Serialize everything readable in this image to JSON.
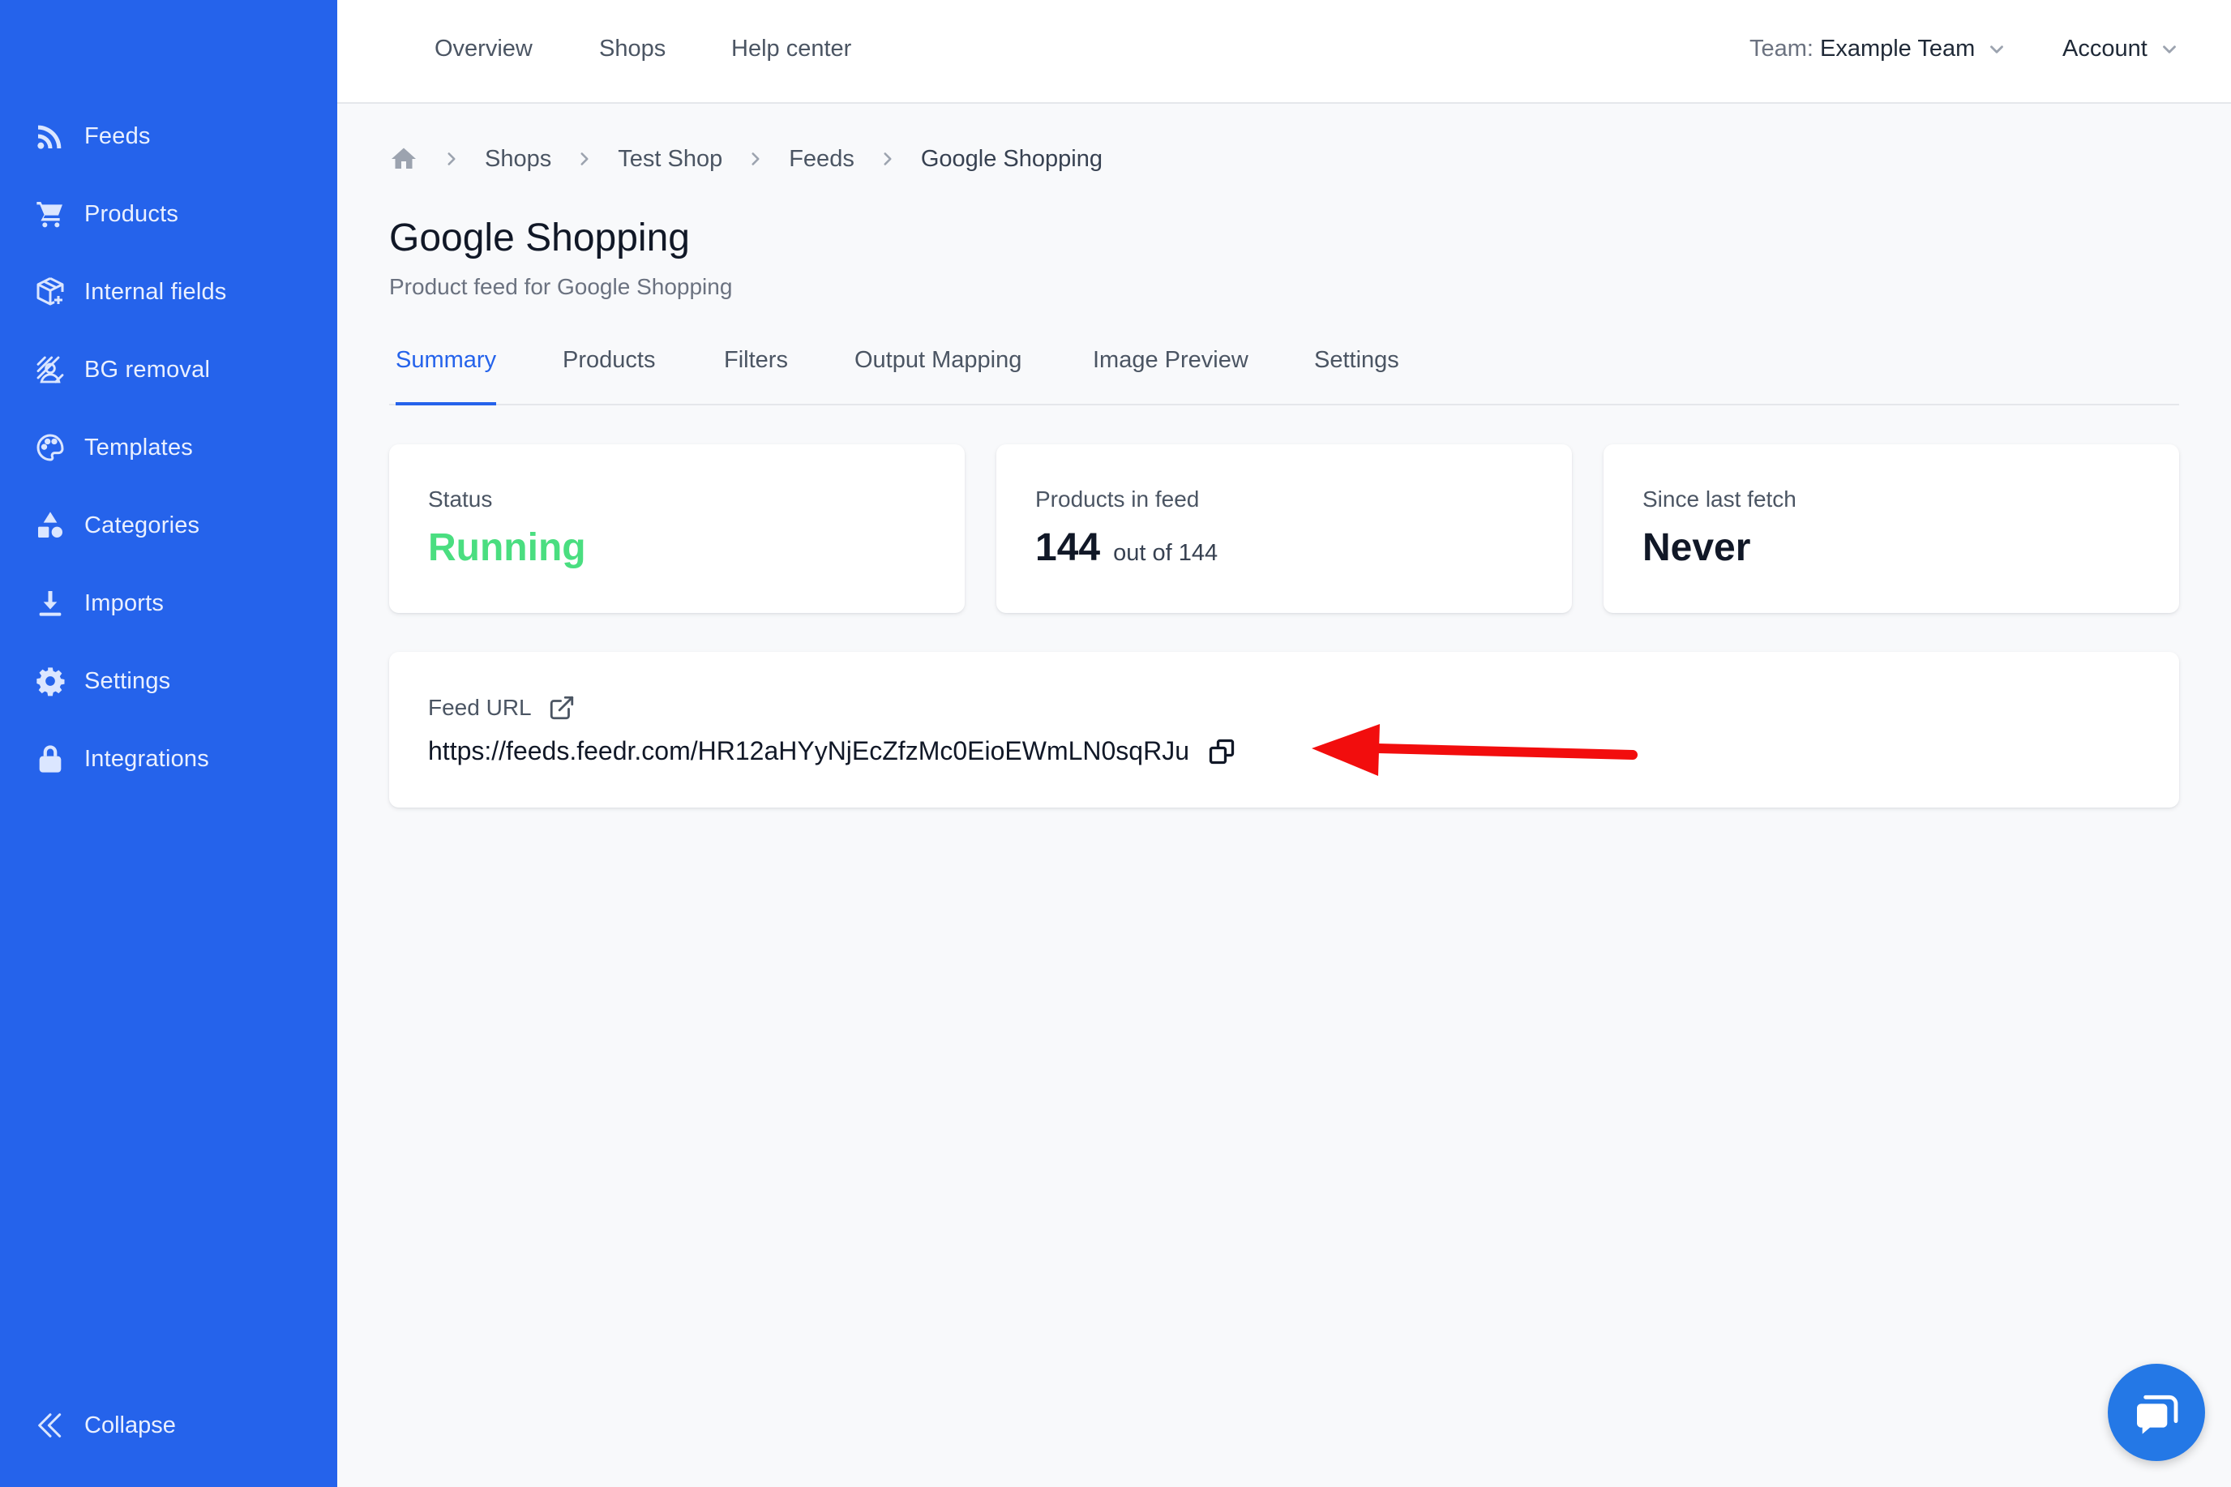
{
  "sidebar": {
    "items": [
      {
        "label": "Feeds",
        "icon": "rss-icon"
      },
      {
        "label": "Products",
        "icon": "cart-icon"
      },
      {
        "label": "Internal fields",
        "icon": "box-plus-icon"
      },
      {
        "label": "BG removal",
        "icon": "bg-removal-icon"
      },
      {
        "label": "Templates",
        "icon": "palette-icon"
      },
      {
        "label": "Categories",
        "icon": "shapes-icon"
      },
      {
        "label": "Imports",
        "icon": "download-icon"
      },
      {
        "label": "Settings",
        "icon": "gear-icon"
      },
      {
        "label": "Integrations",
        "icon": "lock-icon"
      }
    ],
    "collapse_label": "Collapse"
  },
  "topnav": {
    "links": [
      "Overview",
      "Shops",
      "Help center"
    ],
    "team_prefix": "Team:",
    "team_value": "Example Team",
    "account_label": "Account"
  },
  "breadcrumb": [
    "Shops",
    "Test Shop",
    "Feeds",
    "Google Shopping"
  ],
  "page": {
    "title": "Google Shopping",
    "subtitle": "Product feed for Google Shopping"
  },
  "tabs": [
    "Summary",
    "Products",
    "Filters",
    "Output Mapping",
    "Image Preview",
    "Settings"
  ],
  "active_tab": "Summary",
  "stats": {
    "status_label": "Status",
    "status_value": "Running",
    "products_label": "Products in feed",
    "products_value": "144",
    "products_sub": "out of 144",
    "fetch_label": "Since last fetch",
    "fetch_value": "Never"
  },
  "feed": {
    "label": "Feed URL",
    "url": "https://feeds.feedr.com/HR12aHYyNjEcZfzMc0EioEWmLN0sqRJu"
  },
  "colors": {
    "sidebar": "#2563eb",
    "accent": "#2563eb",
    "running": "#4ade80",
    "annotation_arrow": "#f20d0d"
  }
}
